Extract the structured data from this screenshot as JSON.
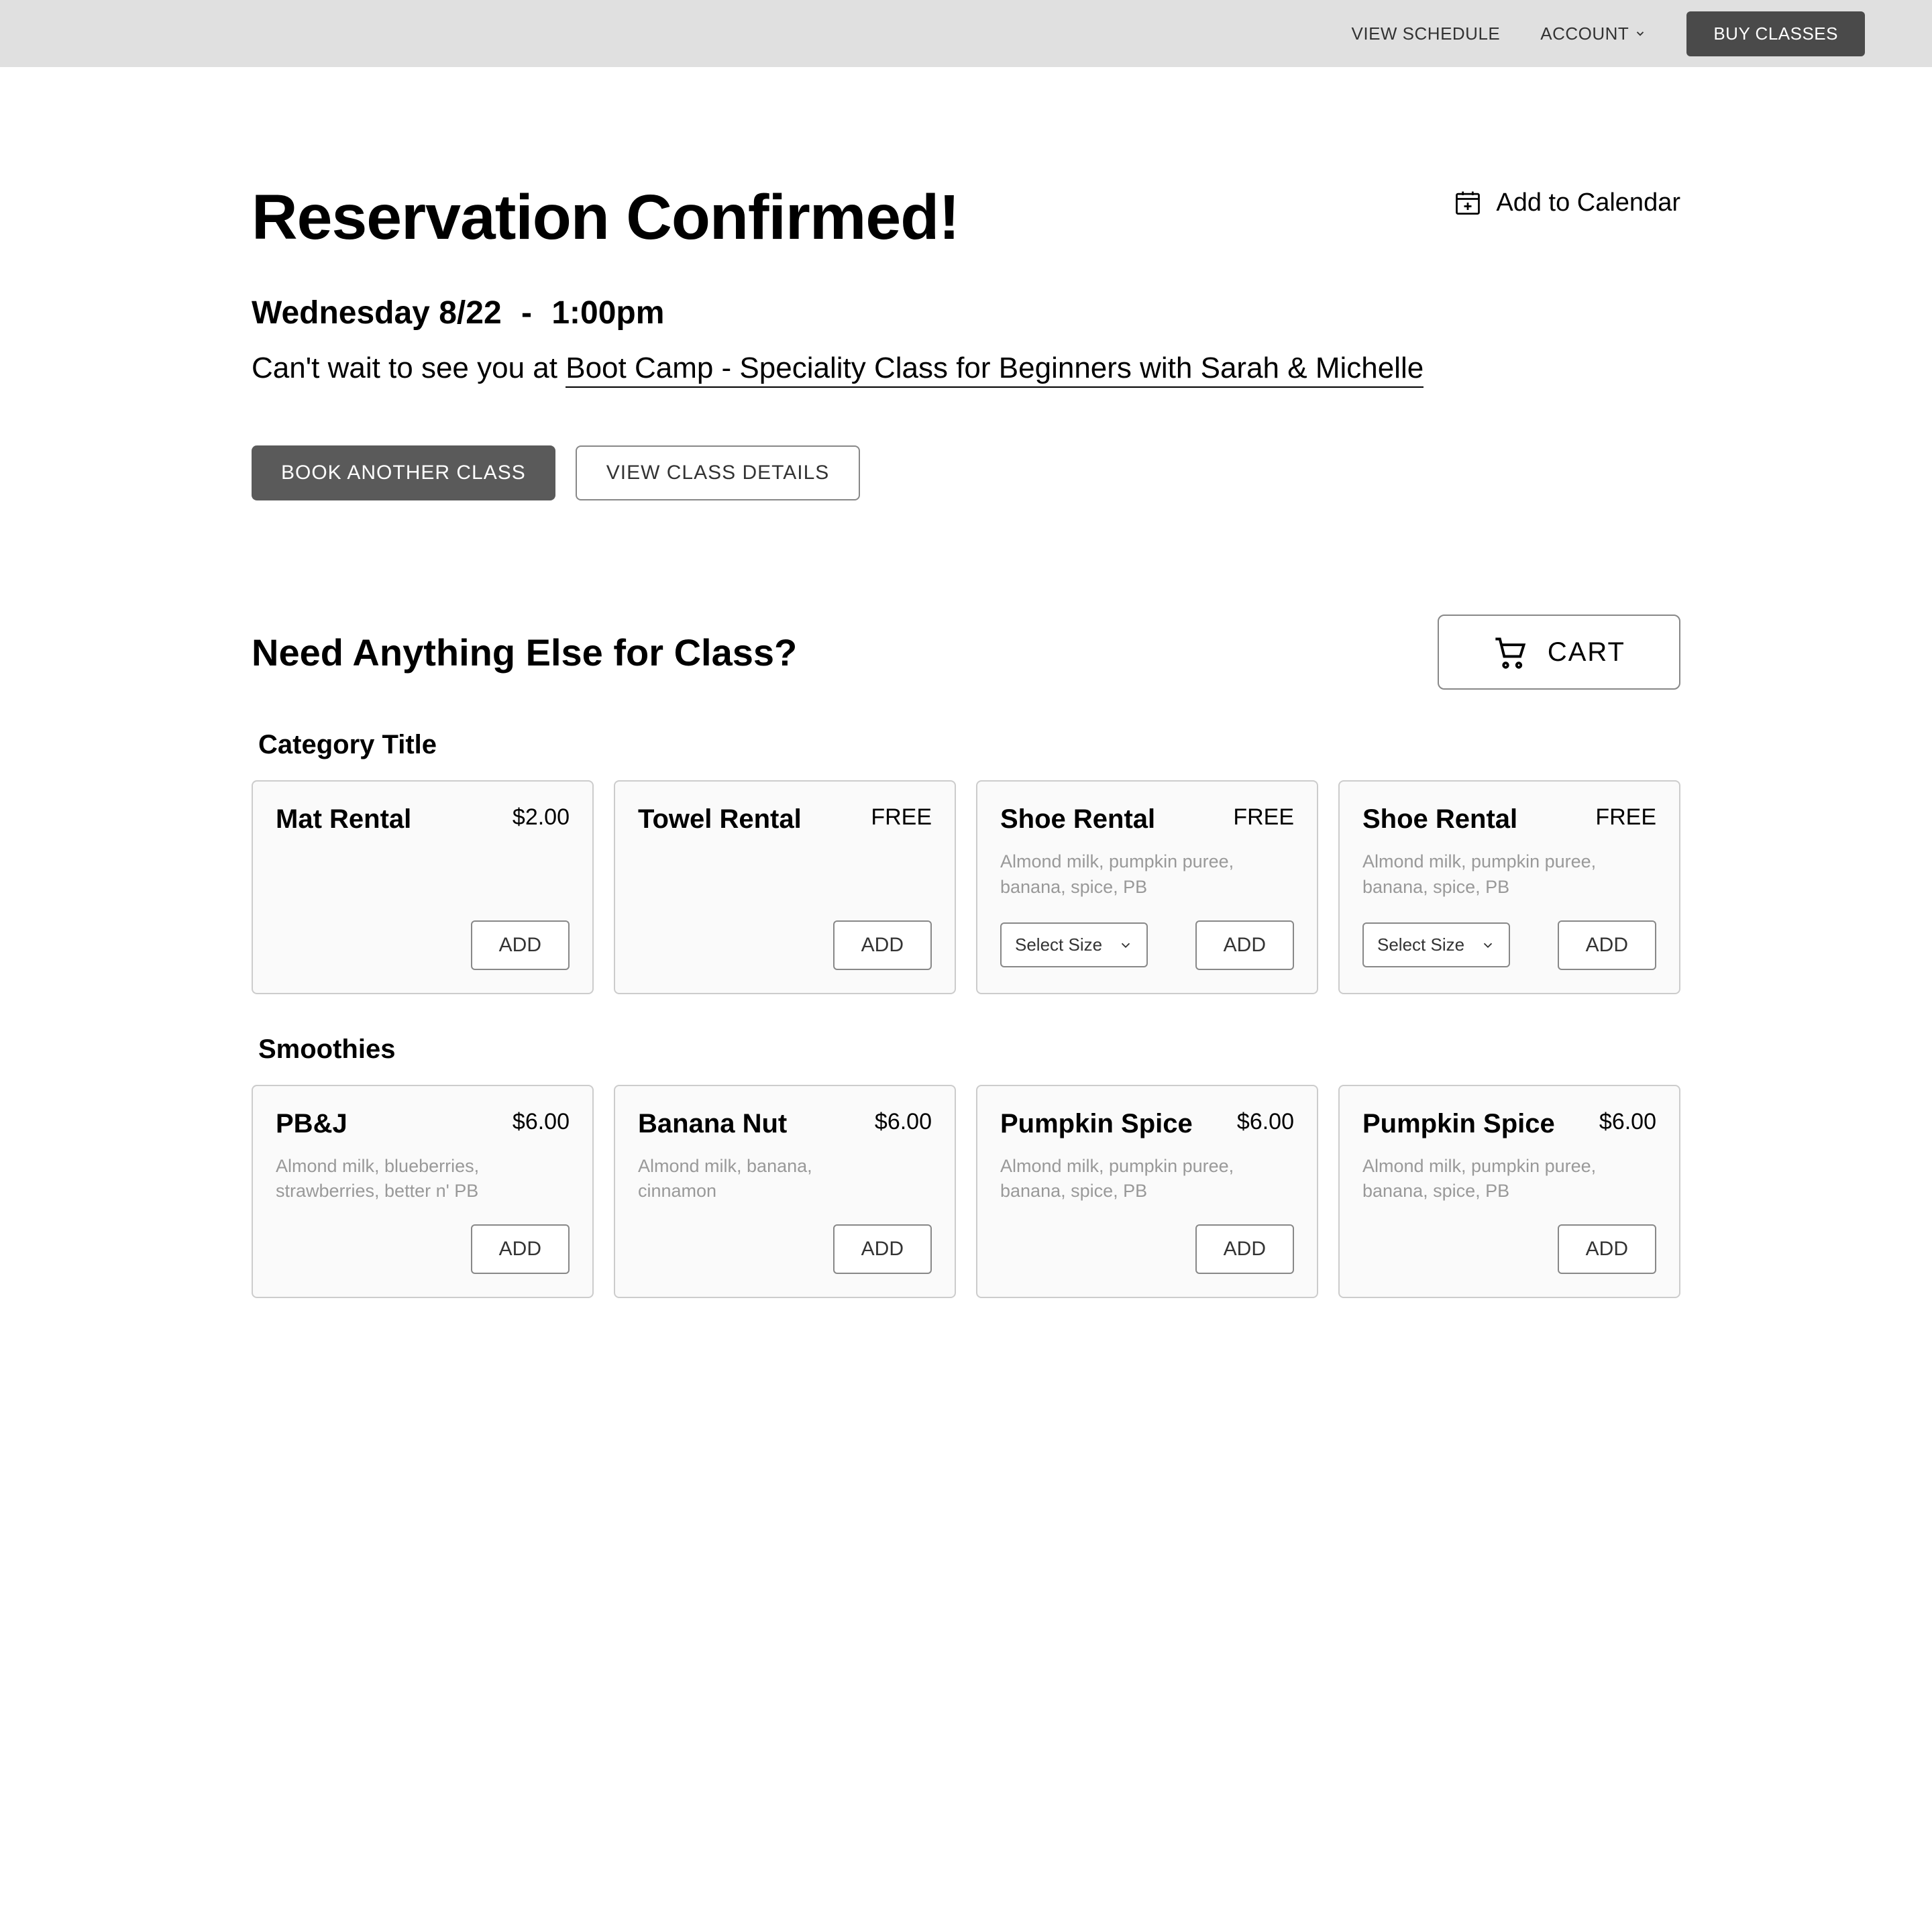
{
  "topbar": {
    "view_schedule": "VIEW SCHEDULE",
    "account": "ACCOUNT",
    "buy_classes": "BUY CLASSES"
  },
  "header": {
    "title": "Reservation Confirmed!",
    "add_to_calendar": "Add to Calendar"
  },
  "reservation": {
    "date": "Wednesday 8/22",
    "separator": "-",
    "time": "1:00pm",
    "intro_prefix": "Can't wait to see you at ",
    "class_name": "Boot Camp - Speciality Class for Beginners with Sarah & Michelle"
  },
  "buttons": {
    "book_another": "BOOK ANOTHER CLASS",
    "view_details": "VIEW CLASS DETAILS"
  },
  "addons": {
    "heading": "Need Anything Else for Class?",
    "cart_label": "CART",
    "add_label": "ADD",
    "select_placeholder": "Select Size",
    "categories": [
      {
        "title": "Category Title",
        "items": [
          {
            "name": "Mat Rental",
            "price": "$2.00",
            "desc": "",
            "has_select": false
          },
          {
            "name": "Towel Rental",
            "price": "FREE",
            "desc": "",
            "has_select": false
          },
          {
            "name": "Shoe Rental",
            "price": "FREE",
            "desc": "Almond milk, pumpkin puree, banana, spice, PB",
            "has_select": true
          },
          {
            "name": "Shoe Rental",
            "price": "FREE",
            "desc": "Almond milk, pumpkin puree, banana, spice, PB",
            "has_select": true
          }
        ]
      },
      {
        "title": "Smoothies",
        "items": [
          {
            "name": "PB&J",
            "price": "$6.00",
            "desc": "Almond milk, blueberries, strawberries, better n' PB",
            "has_select": false
          },
          {
            "name": "Banana Nut",
            "price": "$6.00",
            "desc": "Almond milk, banana, cinnamon",
            "has_select": false
          },
          {
            "name": "Pumpkin Spice",
            "price": "$6.00",
            "desc": "Almond milk, pumpkin puree, banana, spice, PB",
            "has_select": false
          },
          {
            "name": "Pumpkin Spice",
            "price": "$6.00",
            "desc": "Almond milk, pumpkin puree, banana, spice, PB",
            "has_select": false
          }
        ]
      }
    ]
  }
}
